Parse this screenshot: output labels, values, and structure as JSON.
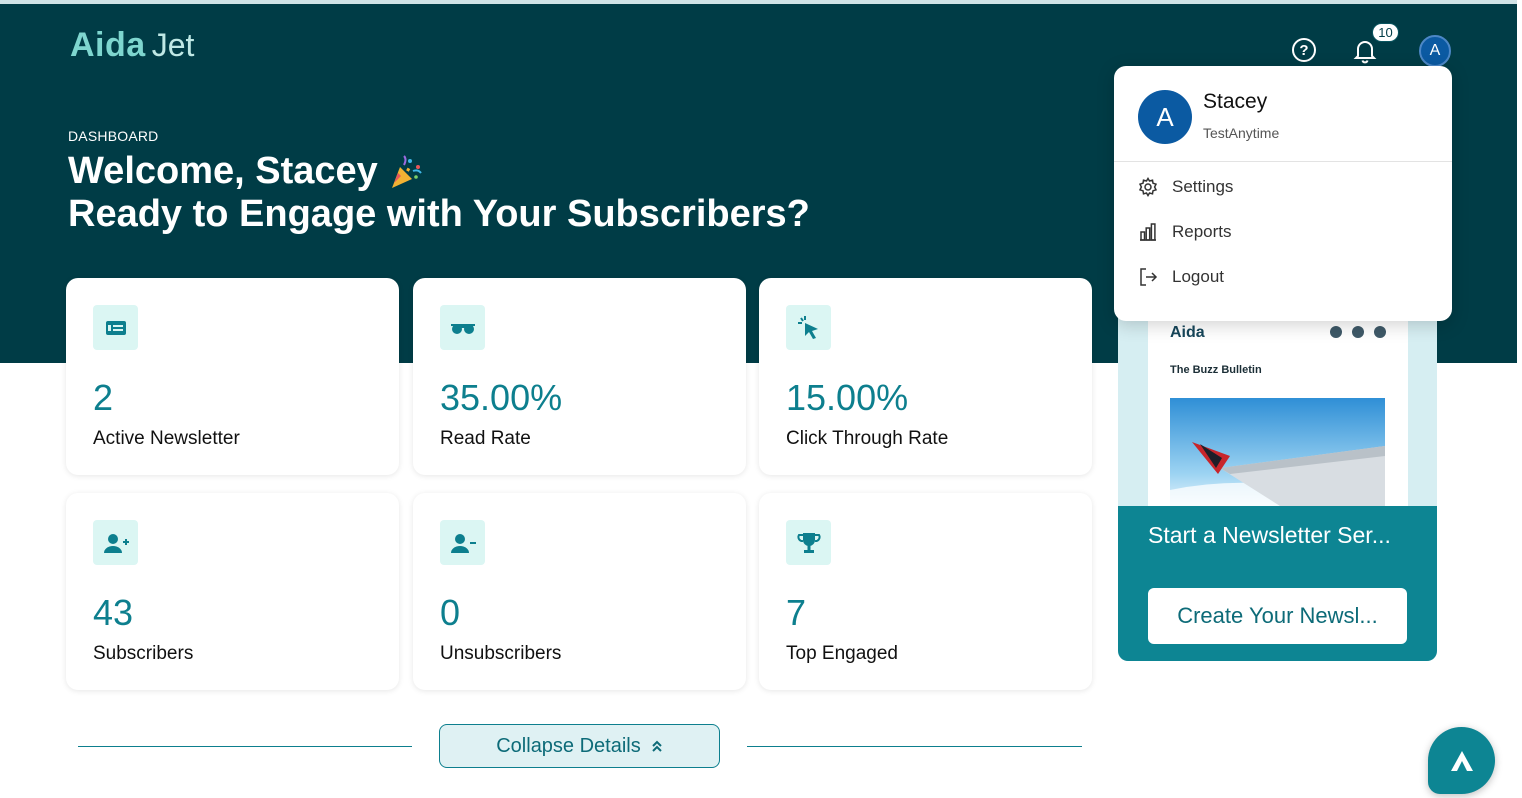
{
  "brand": {
    "logo_part1": "Aida",
    "logo_part2": "Jet"
  },
  "header": {
    "help_label": "?",
    "notification_count": "10",
    "avatar_initial": "A"
  },
  "hero": {
    "kicker": "DASHBOARD",
    "welcome": "Welcome, Stacey",
    "subtitle": "Ready to Engage with Your Subscribers?"
  },
  "stats": [
    {
      "value": "2",
      "label": "Active Newsletter",
      "icon": "newspaper-icon"
    },
    {
      "value": "35.00%",
      "label": "Read Rate",
      "icon": "glasses-icon"
    },
    {
      "value": "15.00%",
      "label": "Click Through Rate",
      "icon": "cursor-click-icon"
    },
    {
      "value": "43",
      "label": "Subscribers",
      "icon": "user-plus-icon"
    },
    {
      "value": "0",
      "label": "Unsubscribers",
      "icon": "user-minus-icon"
    },
    {
      "value": "7",
      "label": "Top Engaged",
      "icon": "trophy-icon"
    }
  ],
  "collapse": {
    "label": "Collapse Details"
  },
  "promo": {
    "mini_logo": "Aida",
    "bulletin": "The Buzz Bulletin",
    "title": "Start a Newsletter Ser...",
    "button": "Create Your Newsl..."
  },
  "menu": {
    "initial": "A",
    "name": "Stacey",
    "org": "TestAnytime",
    "items": [
      {
        "label": "Settings",
        "icon": "gear-icon"
      },
      {
        "label": "Reports",
        "icon": "bar-chart-icon"
      },
      {
        "label": "Logout",
        "icon": "logout-icon"
      }
    ]
  },
  "colors": {
    "hero_bg": "#003c46",
    "accent": "#0d8593",
    "value_text": "#0d7f8e",
    "icon_tile": "#dbf6f3",
    "avatar": "#0b5aa2"
  }
}
